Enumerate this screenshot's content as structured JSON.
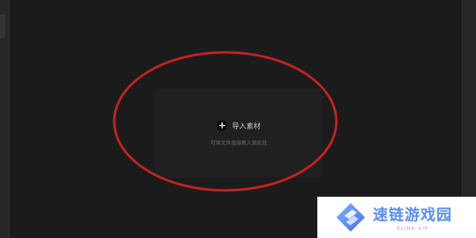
{
  "import_panel": {
    "import_label": "导入素材",
    "hint": "可将文件直接拖入到此处"
  },
  "icons": {
    "import": "plus-icon",
    "watermark_logo": "diamond-logo-icon"
  },
  "highlight": {
    "color": "#c62222"
  },
  "watermark": {
    "name": "速链游戏园",
    "url": "SLINK.VIP",
    "color": "#5b8df0"
  }
}
